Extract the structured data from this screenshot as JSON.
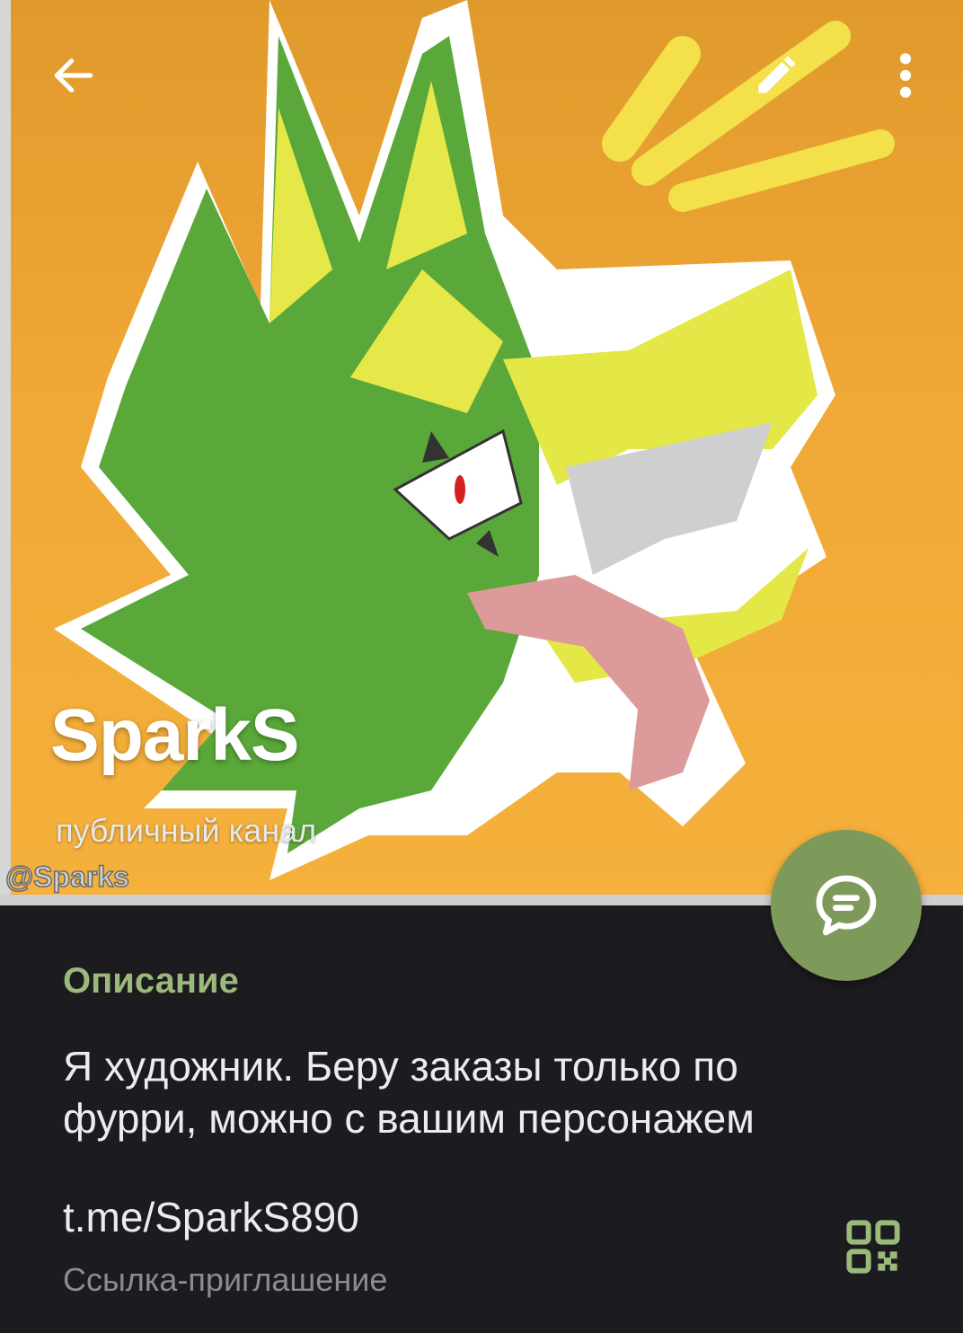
{
  "header": {
    "title": "SparkS",
    "subtitle": "публичный канал",
    "watermark": "@Sparks",
    "colors": {
      "background": "#f0a836",
      "fur_green": "#5aa83a",
      "fur_yellow": "#e6e84a"
    }
  },
  "toolbar": {
    "back_icon": "arrow-left-icon",
    "edit_icon": "pencil-icon",
    "more_icon": "more-vertical-icon"
  },
  "fab": {
    "icon": "message-bubble-icon",
    "color": "#7d9a5b"
  },
  "info": {
    "description_title": "Описание",
    "description_text": "Я художник. Беру заказы только по фурри, можно с вашим персонажем",
    "link": "t.me/SparkS890",
    "link_label": "Ссылка-приглашение",
    "qr_icon": "qr-code-icon",
    "accent": "#9bb97a"
  }
}
